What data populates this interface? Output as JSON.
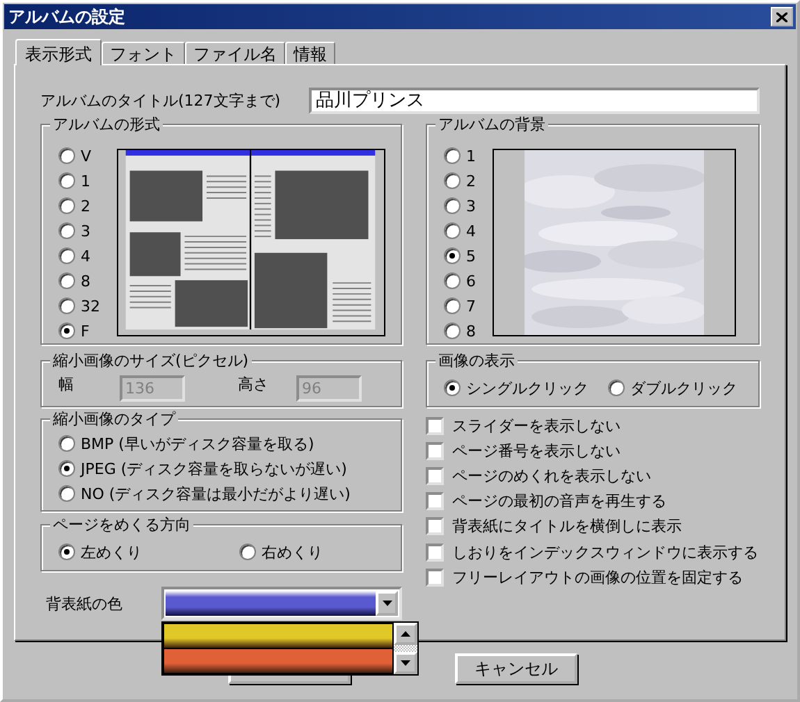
{
  "window": {
    "title": "アルバムの設定"
  },
  "tabs": [
    {
      "label": "表示形式",
      "selected": true
    },
    {
      "label": "フォント",
      "selected": false
    },
    {
      "label": "ファイル名",
      "selected": false
    },
    {
      "label": "情報",
      "selected": false
    }
  ],
  "album_title": {
    "label": "アルバムのタイトル(127文字まで)",
    "value": "品川プリンス"
  },
  "album_format": {
    "legend": "アルバムの形式",
    "options": [
      {
        "label": "V",
        "selected": false
      },
      {
        "label": "1",
        "selected": false
      },
      {
        "label": "2",
        "selected": false
      },
      {
        "label": "3",
        "selected": false
      },
      {
        "label": "4",
        "selected": false
      },
      {
        "label": "8",
        "selected": false
      },
      {
        "label": "32",
        "selected": false
      },
      {
        "label": "F",
        "selected": true
      }
    ]
  },
  "album_background": {
    "legend": "アルバムの背景",
    "options": [
      {
        "label": "1",
        "selected": false
      },
      {
        "label": "2",
        "selected": false
      },
      {
        "label": "3",
        "selected": false
      },
      {
        "label": "4",
        "selected": false
      },
      {
        "label": "5",
        "selected": true
      },
      {
        "label": "6",
        "selected": false
      },
      {
        "label": "7",
        "selected": false
      },
      {
        "label": "8",
        "selected": false
      }
    ]
  },
  "thumbnail_size": {
    "legend": "縮小画像のサイズ(ピクセル)",
    "disabled": true,
    "fields": [
      {
        "label": "幅",
        "value": "136"
      },
      {
        "label": "高さ",
        "value": "96"
      }
    ]
  },
  "image_display": {
    "legend": "画像の表示",
    "options": [
      {
        "label": "シングルクリック",
        "selected": true
      },
      {
        "label": "ダブルクリック",
        "selected": false
      }
    ]
  },
  "thumbnail_type": {
    "legend": "縮小画像のタイプ",
    "options": [
      {
        "label": "BMP (早いがディスク容量を取る)",
        "selected": false
      },
      {
        "label": "JPEG (ディスク容量を取らないが遅い)",
        "selected": true
      },
      {
        "label": "NO (ディスク容量は最小だがより遅い)",
        "selected": false
      }
    ]
  },
  "checkboxes": [
    {
      "label": "スライダーを表示しない",
      "checked": false
    },
    {
      "label": "ページ番号を表示しない",
      "checked": false
    },
    {
      "label": "ページのめくれを表示しない",
      "checked": false
    },
    {
      "label": "ページの最初の音声を再生する",
      "checked": false
    },
    {
      "label": "背表紙にタイトルを横倒しに表示",
      "checked": false
    },
    {
      "label": "しおりをインデックスウィンドウに表示する",
      "checked": false
    },
    {
      "label": "フリーレイアウトの画像の位置を固定する",
      "checked": false
    }
  ],
  "page_direction": {
    "legend": "ページをめくる方向",
    "options": [
      {
        "label": "左めくり",
        "selected": true
      },
      {
        "label": "右めくり",
        "selected": false
      }
    ]
  },
  "spine_color": {
    "label": "背表紙の色",
    "color": "#5a5ad0",
    "expanded": true,
    "items": [
      {
        "color": "#e0c828"
      },
      {
        "color": "#e06038"
      }
    ]
  },
  "buttons": [
    {
      "label": "キャンセル"
    }
  ]
}
